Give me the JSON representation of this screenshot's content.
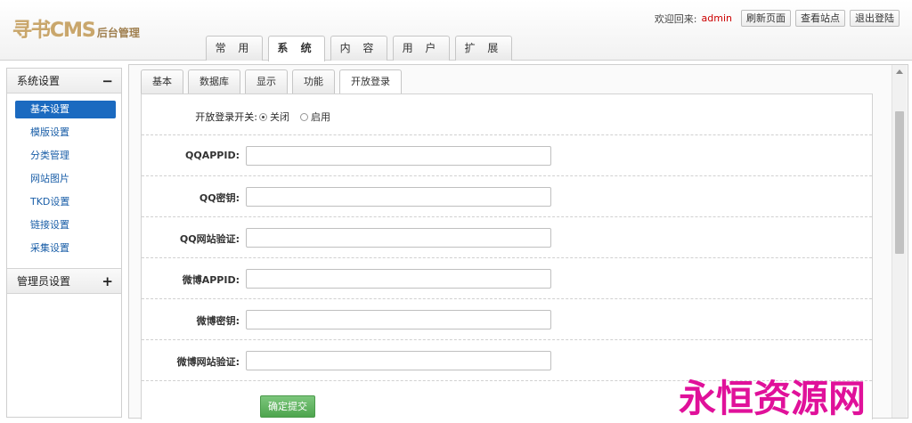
{
  "logo": {
    "main": "寻书CMS",
    "sub": "后台管理"
  },
  "top_bar": {
    "welcome": "欢迎回来:",
    "username": "admin",
    "buttons": [
      "刷新页面",
      "查看站点",
      "退出登陆"
    ]
  },
  "nav": {
    "tabs": [
      "常 用",
      "系 统",
      "内 容",
      "用 户",
      "扩 展"
    ],
    "active": 1
  },
  "sidebar": {
    "sections": [
      {
        "title": "系统设置",
        "toggle": "−",
        "items": [
          "基本设置",
          "模版设置",
          "分类管理",
          "网站图片",
          "TKD设置",
          "链接设置",
          "采集设置"
        ],
        "active": 0
      },
      {
        "title": "管理员设置",
        "toggle": "+"
      }
    ]
  },
  "subtabs": {
    "items": [
      "基本",
      "数据库",
      "显示",
      "功能",
      "开放登录"
    ],
    "active": 4
  },
  "form": {
    "switch": {
      "label": "开放登录开关:",
      "options": [
        "关闭",
        "启用"
      ],
      "selected": 0
    },
    "fields": [
      {
        "label": "QQAPPID:",
        "value": ""
      },
      {
        "label": "QQ密钥:",
        "value": ""
      },
      {
        "label": "QQ网站验证:",
        "value": ""
      },
      {
        "label": "微博APPID:",
        "value": ""
      },
      {
        "label": "微博密钥:",
        "value": ""
      },
      {
        "label": "微博网站验证:",
        "value": ""
      }
    ],
    "submit": "确定提交"
  },
  "watermark": "永恒资源网",
  "colors": {
    "accent": "#1b6ac0",
    "username": "#cc0000",
    "submit": "#4ea54e",
    "watermark": "#e0119a"
  }
}
